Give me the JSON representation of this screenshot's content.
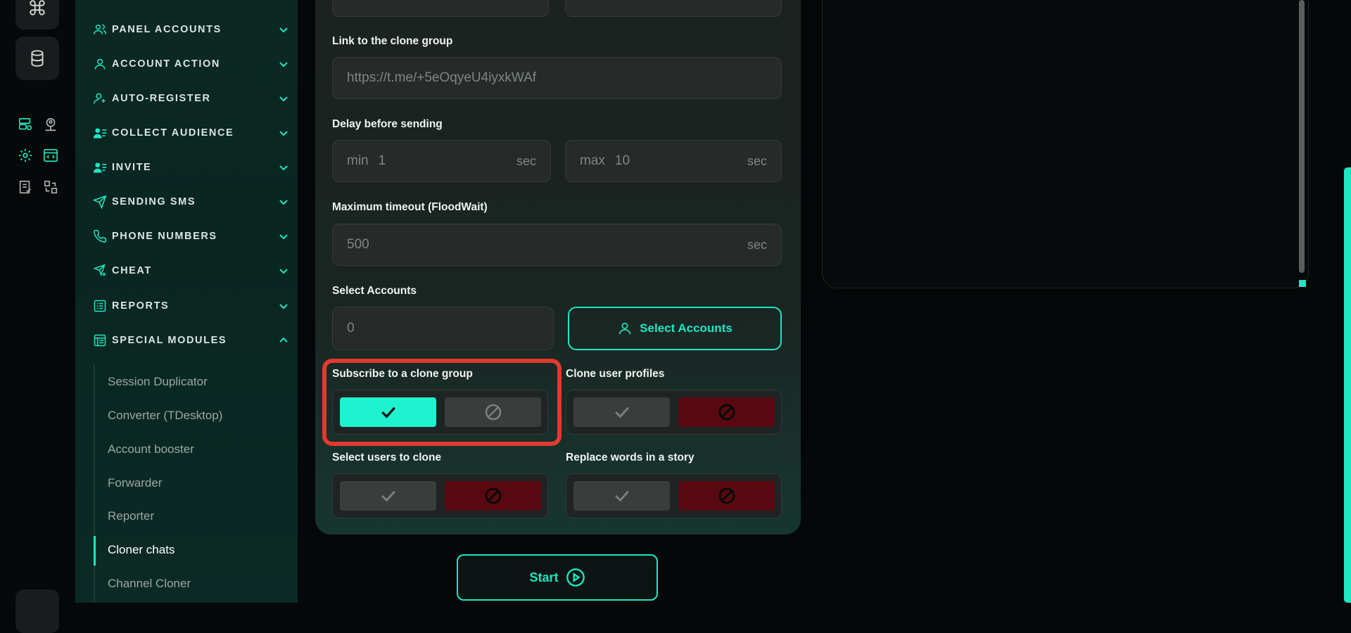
{
  "colors": {
    "accent": "#1fe6c2",
    "toggle_on": "#1ff2cf",
    "toggle_red": "#5a0810",
    "highlight": "#e23a2e"
  },
  "rail": {
    "icons": [
      "command-icon",
      "database-icon",
      "server-settings-icon",
      "user-location-icon",
      "gear-icon",
      "code-window-icon",
      "checklist-icon",
      "swap-icon"
    ]
  },
  "sidebar": {
    "items": [
      {
        "label": "PANEL ACCOUNTS",
        "icon": "users-icon"
      },
      {
        "label": "ACCOUNT ACTION",
        "icon": "user-icon"
      },
      {
        "label": "AUTO-REGISTER",
        "icon": "user-plus-icon"
      },
      {
        "label": "COLLECT AUDIENCE",
        "icon": "user-list-icon"
      },
      {
        "label": "INVITE",
        "icon": "user-list-icon"
      },
      {
        "label": "SENDING SMS",
        "icon": "send-icon"
      },
      {
        "label": "PHONE NUMBERS",
        "icon": "phone-icon"
      },
      {
        "label": "CHEAT",
        "icon": "send-plus-icon"
      },
      {
        "label": "REPORTS",
        "icon": "report-icon"
      },
      {
        "label": "SPECIAL MODULES",
        "icon": "module-icon"
      }
    ],
    "sub_items": [
      {
        "label": "Session Duplicator"
      },
      {
        "label": "Converter (TDesktop)"
      },
      {
        "label": "Account booster"
      },
      {
        "label": "Forwarder"
      },
      {
        "label": "Reporter"
      },
      {
        "label": "Cloner chats"
      },
      {
        "label": "Channel Cloner"
      }
    ]
  },
  "form": {
    "link_label": "Link to the clone group",
    "link_placeholder": "https://t.me/+5eOqyeU4iyxkWAf",
    "delay_label": "Delay before sending",
    "delay_min_prefix": "min",
    "delay_min_value": "1",
    "delay_max_prefix": "max",
    "delay_max_value": "10",
    "unit": "sec",
    "timeout_label": "Maximum timeout (FloodWait)",
    "timeout_value": "500",
    "accounts_label": "Select Accounts",
    "accounts_count": "0",
    "select_accounts_button": "Select Accounts",
    "toggles": [
      {
        "label": "Subscribe to a clone group",
        "state": "on"
      },
      {
        "label": "Clone user profiles",
        "state": "off"
      },
      {
        "label": "Select users to clone",
        "state": "off"
      },
      {
        "label": "Replace words in a story",
        "state": "off"
      }
    ],
    "start_button": "Start"
  }
}
